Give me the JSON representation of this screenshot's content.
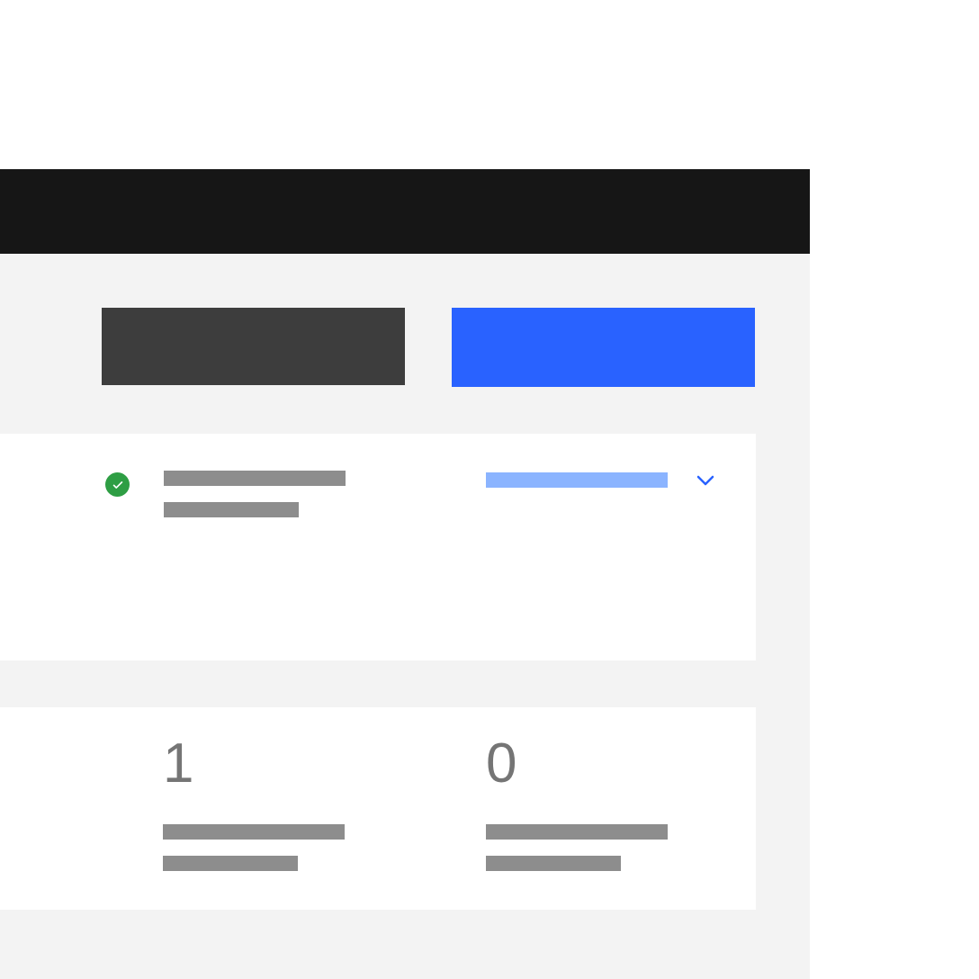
{
  "header": {
    "title": ""
  },
  "tabs": [
    {
      "label": "",
      "variant": "dark"
    },
    {
      "label": "",
      "variant": "blue"
    }
  ],
  "status": {
    "line1": "",
    "line2": "",
    "dropdown_label": "",
    "status_icon": "check-circle"
  },
  "metrics": [
    {
      "value": "1",
      "line1": "",
      "line2": ""
    },
    {
      "value": "0",
      "line1": "",
      "line2": ""
    }
  ],
  "colors": {
    "header_bg": "#161616",
    "page_bg": "#f3f3f3",
    "tab_dark": "#3d3d3d",
    "tab_blue": "#2962ff",
    "success": "#2e9e44",
    "skeleton": "#8d8d8d",
    "skeleton_light": "#8bb4ff",
    "metric_text": "#757575"
  }
}
